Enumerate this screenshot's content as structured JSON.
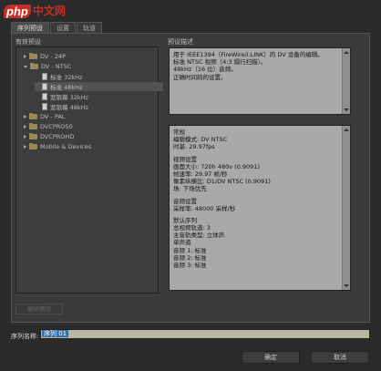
{
  "logo": {
    "php": "php",
    "cn": "中文网"
  },
  "tabs": [
    "序列预设",
    "设置",
    "轨道"
  ],
  "labels": {
    "available_presets": "有效预设",
    "preset_description": "预设描述"
  },
  "tree": [
    {
      "label": "DV - 24P",
      "icon": "folder-icon",
      "expanded": false
    },
    {
      "label": "DV - NTSC",
      "icon": "folder-icon",
      "expanded": true
    },
    {
      "label": "标准 32kHz",
      "icon": "file-icon"
    },
    {
      "label": "标准 48kHz",
      "icon": "file-icon",
      "selected": true
    },
    {
      "label": "宽银幕 32kHz",
      "icon": "file-icon"
    },
    {
      "label": "宽银幕 48kHz",
      "icon": "file-icon"
    },
    {
      "label": "DV - PAL",
      "icon": "folder-icon",
      "expanded": false
    },
    {
      "label": "DVCPRO50",
      "icon": "folder-icon",
      "expanded": false
    },
    {
      "label": "DVCPROHD",
      "icon": "folder-icon",
      "expanded": false
    },
    {
      "label": "Mobile & Devices",
      "icon": "folder-icon",
      "expanded": false
    }
  ],
  "description": [
    "用于 IEEE1394（FireWire/i.LINK）的 DV 设备的编辑。",
    "标准 NTSC 视频（4:3 隔行扫描）。",
    "48kHz（16 位）音频。",
    "正确时间码的设置。"
  ],
  "details": [
    "常规",
    " 编辑模式: DV NTSC",
    " 时基: 29.97fps",
    "",
    "视频设置",
    " 画面大小: 720h 480v (0.9091)",
    " 帧速率: 29.97 帧/秒",
    " 像素纵横比: D1/DV NTSC (0.9091)",
    " 场: 下场优先",
    "",
    "音频设置",
    " 采样率: 48000 采样/秒",
    "",
    "默认序列",
    " 总视频轨道: 3",
    " 主音轨类型: 立体声",
    " 单声道",
    " 音频 1: 标准",
    " 音频 2: 标准",
    " 音频 3: 标准"
  ],
  "delete_button": "删除预设",
  "sequence_name_label": "序列名称:",
  "sequence_name_value": "序列 01",
  "ok_button": "确定",
  "cancel_button": "取消"
}
